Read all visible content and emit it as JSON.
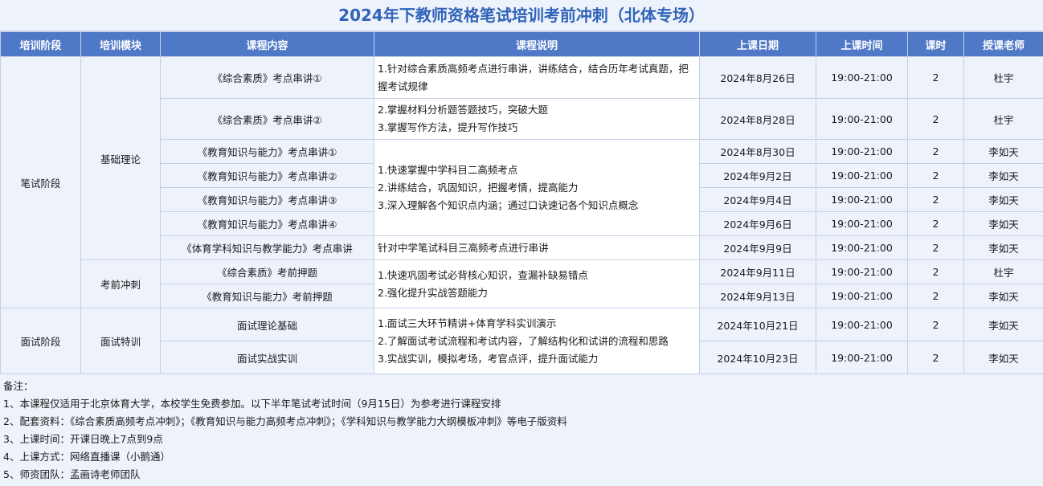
{
  "title": "2024年下教师资格笔试培训考前冲刺（北体专场）",
  "headers": [
    "培训阶段",
    "培训模块",
    "课程内容",
    "课程说明",
    "上课日期",
    "上课时间",
    "课时",
    "授课老师"
  ],
  "stages": {
    "written": "笔试阶段",
    "interview": "面试阶段"
  },
  "modules": {
    "basic": "基础理论",
    "sprint": "考前冲刺",
    "interview_training": "面试特训"
  },
  "rows": [
    {
      "content": "《综合素质》考点串讲①",
      "date": "2024年8月26日",
      "time": "19:00-21:00",
      "hours": "2",
      "teacher": "杜宇"
    },
    {
      "content": "《综合素质》考点串讲②",
      "date": "2024年8月28日",
      "time": "19:00-21:00",
      "hours": "2",
      "teacher": "杜宇"
    },
    {
      "content": "《教育知识与能力》考点串讲①",
      "date": "2024年8月30日",
      "time": "19:00-21:00",
      "hours": "2",
      "teacher": "李如天"
    },
    {
      "content": "《教育知识与能力》考点串讲②",
      "date": "2024年9月2日",
      "time": "19:00-21:00",
      "hours": "2",
      "teacher": "李如天"
    },
    {
      "content": "《教育知识与能力》考点串讲③",
      "date": "2024年9月4日",
      "time": "19:00-21:00",
      "hours": "2",
      "teacher": "李如天"
    },
    {
      "content": "《教育知识与能力》考点串讲④",
      "date": "2024年9月6日",
      "time": "19:00-21:00",
      "hours": "2",
      "teacher": "李如天"
    },
    {
      "content": "《体育学科知识与教学能力》考点串讲",
      "date": "2024年9月9日",
      "time": "19:00-21:00",
      "hours": "2",
      "teacher": "李如天"
    },
    {
      "content": "《综合素质》考前押题",
      "date": "2024年9月11日",
      "time": "19:00-21:00",
      "hours": "2",
      "teacher": "杜宇"
    },
    {
      "content": "《教育知识与能力》考前押题",
      "date": "2024年9月13日",
      "time": "19:00-21:00",
      "hours": "2",
      "teacher": "李如天"
    },
    {
      "content": "面试理论基础",
      "date": "2024年10月21日",
      "time": "19:00-21:00",
      "hours": "2",
      "teacher": "李如天"
    },
    {
      "content": "面试实战实训",
      "date": "2024年10月23日",
      "time": "19:00-21:00",
      "hours": "2",
      "teacher": "李如天"
    }
  ],
  "descriptions": {
    "d1": "1.针对综合素质高频考点进行串讲，讲练结合，结合历年考试真题，把握考试规律",
    "d2a": "2.掌握材料分析题答题技巧，突破大题",
    "d2b": "3.掌握写作方法，提升写作技巧",
    "d3a": "1.快速掌握中学科目二高频考点",
    "d3b": "2.讲练结合，巩固知识，把握考情，提高能力",
    "d3c": "3.深入理解各个知识点内涵；通过口诀速记各个知识点概念",
    "d4": "针对中学笔试科目三高频考点进行串讲",
    "d5a": "1.快速巩固考试必背核心知识，查漏补缺易错点",
    "d5b": "2.强化提升实战答题能力",
    "d6a": "1.面试三大环节精讲+体育学科实训演示",
    "d6b": "2.了解面试考试流程和考试内容，了解结构化和试讲的流程和思路",
    "d6c": "3.实战实训，模拟考场，考官点评，提升面试能力"
  },
  "notes": [
    "备注：",
    "1、本课程仅适用于北京体育大学，本校学生免费参加。以下半年笔试考试时间（9月15日）为参考进行课程安排",
    "2、配套资料：《综合素质高频考点冲刺》；《教育知识与能力高频考点冲刺》；《学科知识与教学能力大纲模板冲刺》等电子版资料",
    "3、上课时间：开课日晚上7点到9点",
    "4、上课方式：网络直播课（小鹅通）",
    "5、师资团队：孟画诗老师团队"
  ]
}
